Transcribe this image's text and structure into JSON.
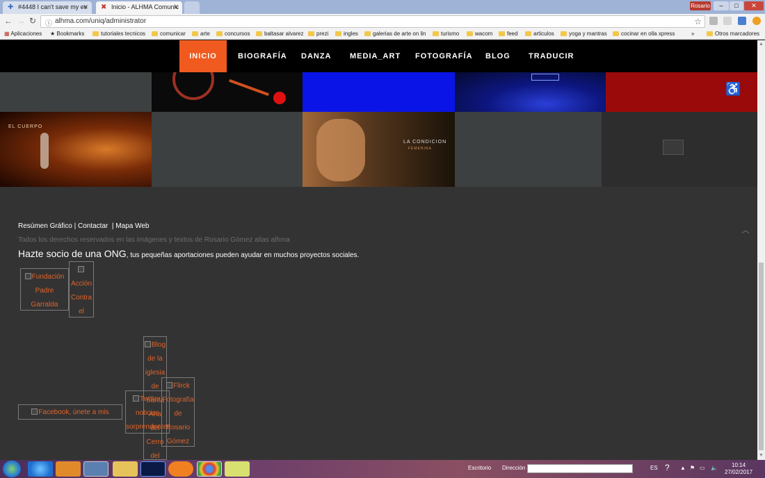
{
  "browser": {
    "tabs": [
      {
        "label": "#4448 I can't save my ev"
      },
      {
        "label": "Inicio - ALHMA Comunic"
      }
    ],
    "user_chip": "Rosario",
    "url": "alhma.com/uniq/administrator",
    "bookmarks": [
      {
        "label": "Aplicaciones"
      },
      {
        "label": "Bookmarks"
      },
      {
        "label": "tutoriales tecnicos"
      },
      {
        "label": "comunicar"
      },
      {
        "label": "arte"
      },
      {
        "label": "concursos"
      },
      {
        "label": "baltasar alvarez"
      },
      {
        "label": "prezi"
      },
      {
        "label": "ingles"
      },
      {
        "label": "galerias de arte on lin"
      },
      {
        "label": "turismo"
      },
      {
        "label": "wacom"
      },
      {
        "label": "feed"
      },
      {
        "label": "articulos"
      },
      {
        "label": "yoga y mantras"
      },
      {
        "label": "cocinar en olla xpress"
      },
      {
        "label": "»"
      },
      {
        "label": "Otros marcadores"
      }
    ]
  },
  "nav": {
    "items": [
      "INICIO",
      "BIOGRAFÍA",
      "DANZA",
      "MEDIA_ART",
      "FOTOGRAFÍA",
      "BLOG",
      "TRADUCIR"
    ]
  },
  "tiles": {
    "cuerpo_label": "EL CUERPO",
    "condicion_label": "LA CONDICION",
    "condicion_sub": "FEMENINA"
  },
  "footer": {
    "link_resumen": "Resúmen Gráfico",
    "sep1": "|",
    "link_contactar": "Contactar",
    "sep2": "|",
    "link_mapa": "Mapa Web",
    "copyright": "Todos los derechos reservados en las imágenes y textos de Rosario Gómez alias alhma",
    "ong_big": "Hazte socio de una ONG",
    "ong_small": ", tus pequeñas aportaciones pueden ayudar en muchos proyectos sociales."
  },
  "broken_images": {
    "fundacion": "Fundación Padre Garralda",
    "accion": "Acción Contra el Hambre",
    "blog_iglesia": "Blog de la iglesia de Santa Ana del Cerro del",
    "flickr": "Flirck Fotografía de Rosario Gómez",
    "twitter": "Twitter, noticias sorprendentes",
    "facebook": "Facebook, únete a mis amistades"
  },
  "taskbar": {
    "escritorio": "Escritorio",
    "direccion": "Dirección",
    "lang": "ES",
    "time": "10:14",
    "date": "27/02/2017"
  },
  "colors": {
    "accent": "#f05a1e",
    "nav_bg": "#000000",
    "page_bg": "#333333",
    "broken_text": "#e0642a"
  }
}
